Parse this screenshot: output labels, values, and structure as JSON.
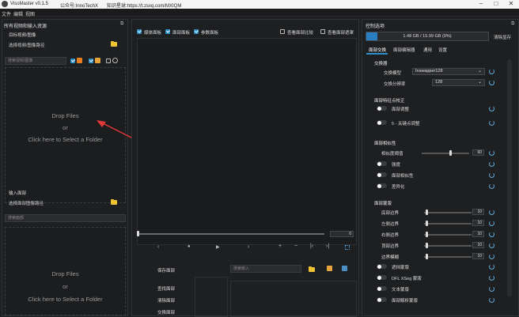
{
  "window": {
    "title": "VisoMaster v0.1.5",
    "wechat": "公众号:InnoTechX",
    "zsxq": "知识星球:https://t.zsxq.com/MXIQM"
  },
  "menu": [
    "文件",
    "编辑",
    "视图"
  ],
  "left": {
    "header": "所有视频和输入资源",
    "target_section": "目标视频/图像",
    "target_select": "选择视频/图像路径",
    "target_search": "搜索视频/图像",
    "drop_files": "Drop Files",
    "or": "or",
    "click_here": "Click here to Select a Folder",
    "input_section": "输入面部",
    "input_select": "选择面部图像路径",
    "input_search": "搜索面部"
  },
  "center": {
    "cb1": "媒体面板",
    "cb2": "面部面板",
    "cb3": "参数面板",
    "cb4": "查看面部比较",
    "cb5": "查看面部遮罩",
    "frame_value": "0",
    "save_folder": "保存面部",
    "search_embed": "搜索嵌入",
    "find_faces": "查找面部",
    "clear_faces": "清除面部",
    "swap_faces": "交换面部"
  },
  "right": {
    "header": "控制选项",
    "memory": "1.48 GB / 15.99 GB (9%)",
    "memory_fraction": 0.093,
    "clear_vram": "清除显存",
    "tabs": [
      "面部交换",
      "面部编辑器",
      "通用",
      "设置"
    ],
    "swap": {
      "title": "交换器",
      "model_label": "交换模型",
      "model_value": "Inswapper128",
      "res_label": "交换分辨率",
      "res_value": "128"
    },
    "restorer": {
      "title": "面部特征点校正",
      "t1": "面部调整",
      "t2": "5 - 关键点调整"
    },
    "similarity": {
      "title": "面部相似性",
      "s1": "相似度阈值",
      "s1_value": "60",
      "t1": "强度",
      "t2": "面部相似性",
      "t3": "差异化"
    },
    "mask": {
      "title": "面部蒙版",
      "border_bottom": "底部边界",
      "border_left": "左侧边界",
      "border_right": "右侧边界",
      "border_top": "顶部边界",
      "border_blur": "边界模糊",
      "val": "10",
      "t1": "遮挡蒙版",
      "t2": "DFL XSeg 蒙版",
      "t3": "文本蒙版",
      "t4": "面部解析蒙版"
    }
  }
}
